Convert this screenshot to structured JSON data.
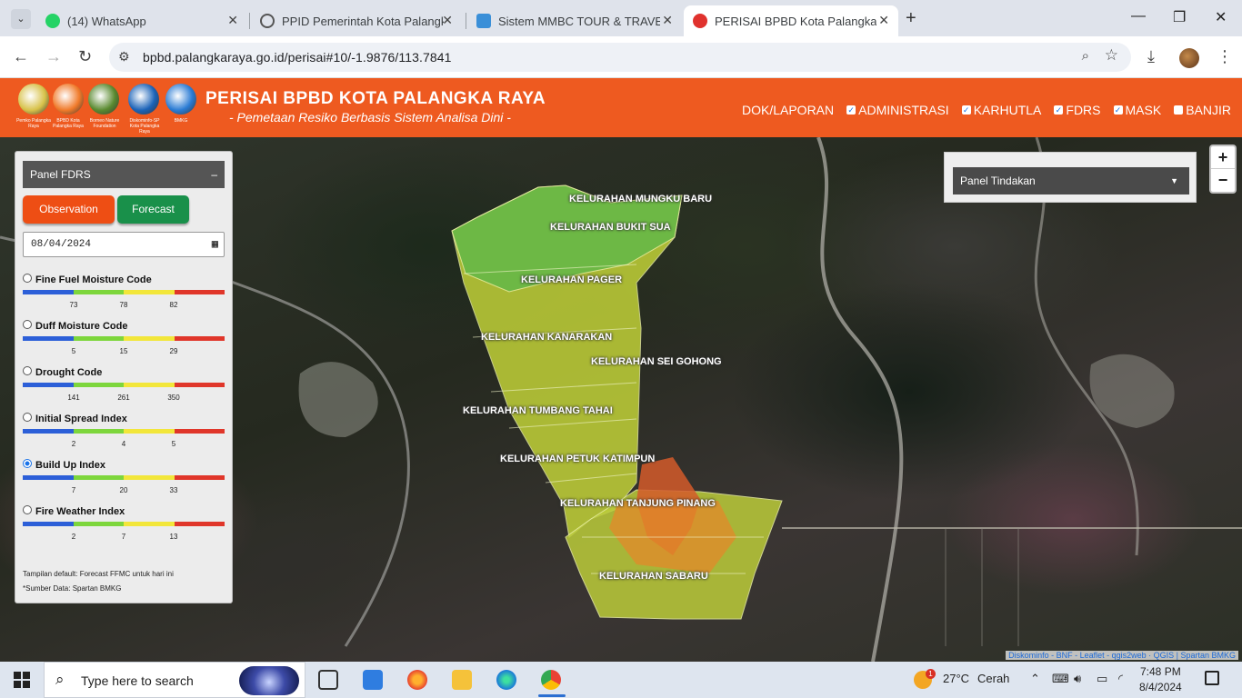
{
  "browser": {
    "tabs": [
      {
        "label": "(14) WhatsApp",
        "icon": "whatsapp-icon",
        "color": "#25d366"
      },
      {
        "label": "PPID Pemerintah Kota Palangka",
        "icon": "globe-icon",
        "color": "#555555"
      },
      {
        "label": "Sistem MMBC TOUR & TRAVEL",
        "icon": "mmbc-icon",
        "color": "#3a8fd8"
      },
      {
        "label": "PERISAI BPBD Kota Palangka Ra",
        "icon": "perisai-icon",
        "color": "#e0322d"
      }
    ],
    "url": "bpbd.palangkaraya.go.id/perisai#10/-1.9876/113.7841"
  },
  "header": {
    "title": "PERISAI BPBD KOTA PALANGKA RAYA",
    "subtitle": "- Pemetaan Resiko Berbasis Sistem Analisa Dini -",
    "logos": [
      {
        "caption": "Pemko Palangka Raya",
        "color": "#d8c24a"
      },
      {
        "caption": "BPBD Kota Palangka Raya",
        "color": "#f07a2a"
      },
      {
        "caption": "Borneo Nature Foundation",
        "color": "#5a8a30"
      },
      {
        "caption": "Diskominfo-SP Kota Palangka Raya",
        "color": "#1b63b8"
      },
      {
        "caption": "BMKG",
        "color": "#2a7bd4"
      }
    ],
    "menu": [
      {
        "label": "DOK/LAPORAN",
        "checkbox": false
      },
      {
        "label": "ADMINISTRASI",
        "checkbox": true,
        "checked": true
      },
      {
        "label": "KARHUTLA",
        "checkbox": true,
        "checked": true
      },
      {
        "label": "FDRS",
        "checkbox": true,
        "checked": true
      },
      {
        "label": "MASK",
        "checkbox": true,
        "checked": true
      },
      {
        "label": "BANJIR",
        "checkbox": true,
        "checked": false
      }
    ]
  },
  "panel_fdrs": {
    "title": "Panel FDRS",
    "collapse": "–",
    "observation_label": "Observation",
    "forecast_label": "Forecast",
    "date": "08/04/2024",
    "scale_colors": [
      "#2c5fd8",
      "#7dd63c",
      "#f2e63a",
      "#e0362a"
    ],
    "indices": [
      {
        "name": "Fine Fuel Moisture Code",
        "ticks": [
          "73",
          "78",
          "82"
        ],
        "selected": false
      },
      {
        "name": "Duff Moisture Code",
        "ticks": [
          "5",
          "15",
          "29"
        ],
        "selected": false
      },
      {
        "name": "Drought Code",
        "ticks": [
          "141",
          "261",
          "350"
        ],
        "selected": false
      },
      {
        "name": "Initial Spread Index",
        "ticks": [
          "2",
          "4",
          "5"
        ],
        "selected": false
      },
      {
        "name": "Build Up Index",
        "ticks": [
          "7",
          "20",
          "33"
        ],
        "selected": true
      },
      {
        "name": "Fire Weather Index",
        "ticks": [
          "2",
          "7",
          "13"
        ],
        "selected": false
      }
    ],
    "note_1": "Tampilan default: Forecast FFMC untuk hari ini",
    "note_2": "*Sumber Data: Spartan BMKG"
  },
  "panel_tindakan": {
    "title": "Panel Tindakan"
  },
  "map": {
    "kelurahan": [
      "KELURAHAN MUNGKU BARU",
      "KELURAHAN BUKIT SUA",
      "KELURAHAN PAGER",
      "KELURAHAN KANARAKAN",
      "KELURAHAN SEI GOHONG",
      "KELURAHAN TUMBANG TAHAI",
      "KELURAHAN PETUK KATIMPUN",
      "KELURAHAN TANJUNG PINANG",
      "KELURAHAN SABARU"
    ],
    "zoom_in": "+",
    "zoom_out": "−",
    "attribution": "Diskominfo - BNF - Leaflet - qgis2web · QGIS | Spartan BMKG"
  },
  "taskbar": {
    "search_placeholder": "Type here to search",
    "weather_temp": "27°C",
    "weather_desc": "Cerah",
    "weather_badge": "1",
    "time": "7:48 PM",
    "date": "8/4/2024"
  }
}
